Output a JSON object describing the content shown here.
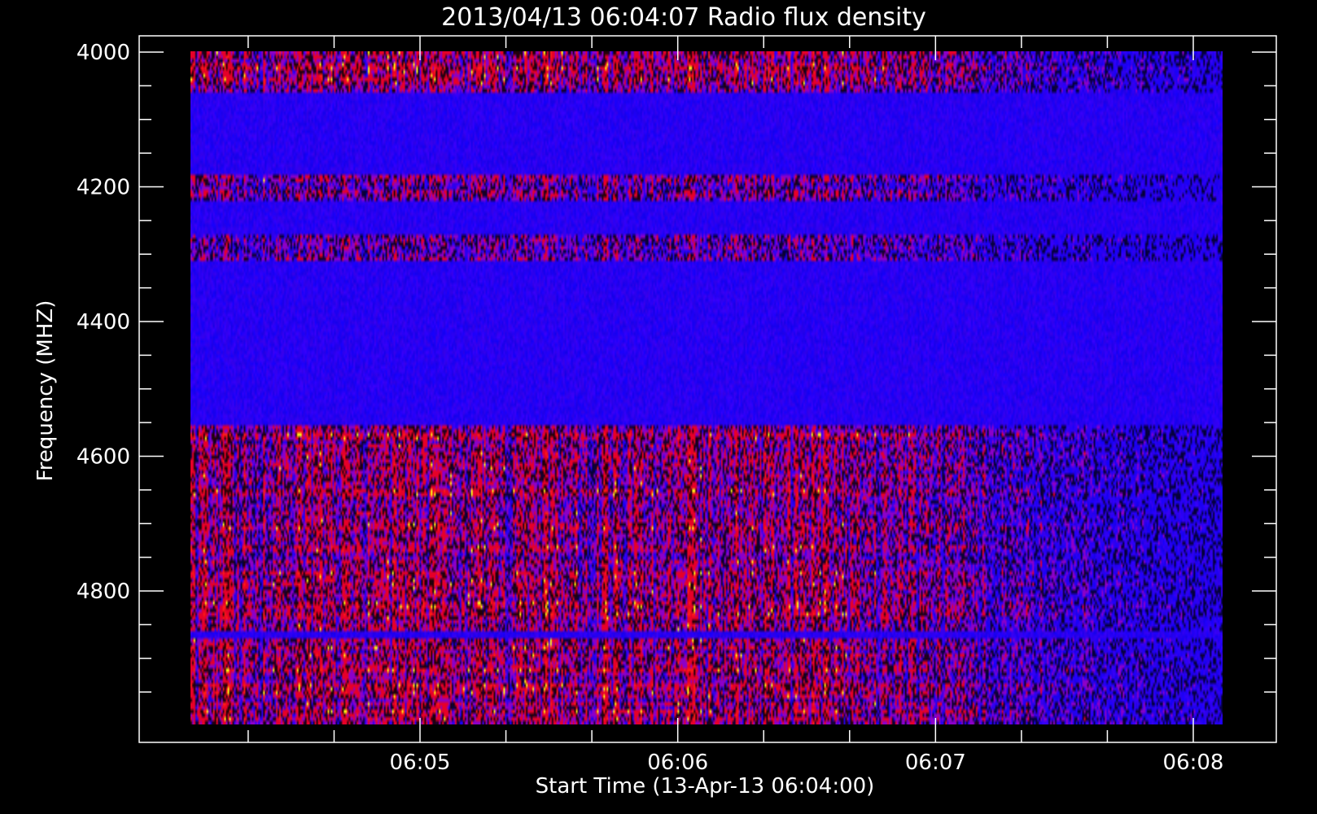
{
  "chart_data": {
    "type": "heatmap",
    "title": "2013/04/13 06:04:07 Radio flux density",
    "xlabel": "Start Time (13-Apr-13 06:04:00)",
    "ylabel": "Frequency (MHZ)",
    "x_ticks": [
      "06:05",
      "06:06",
      "06:07",
      "06:08"
    ],
    "y_ticks": [
      "4000",
      "4200",
      "4400",
      "4600",
      "4800"
    ],
    "x_start": "06:04:07",
    "x_end": "06:08:07",
    "ylim": [
      4000,
      5000
    ],
    "y_inverted": true,
    "colors": {
      "background": "#000000",
      "low": "#0000ff",
      "high": "#ff0000",
      "peak": "#ffff00",
      "axes": "#ffffff"
    }
  }
}
